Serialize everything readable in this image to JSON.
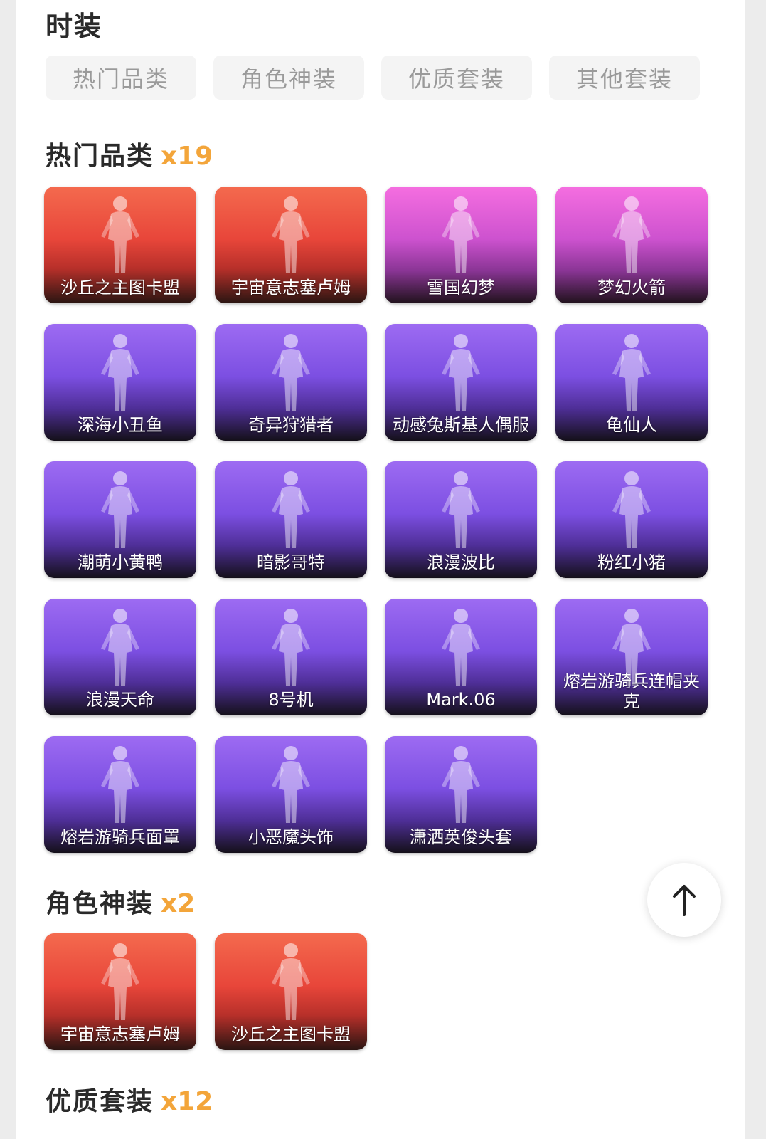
{
  "page": {
    "title": "时装"
  },
  "tabs": [
    {
      "label": "热门品类"
    },
    {
      "label": "角色神装"
    },
    {
      "label": "优质套装"
    },
    {
      "label": "其他套装"
    }
  ],
  "sections": [
    {
      "title": "热门品类",
      "count": "x19",
      "items": [
        {
          "label": "沙丘之主图卡盟",
          "theme": "red"
        },
        {
          "label": "宇宙意志塞卢姆",
          "theme": "red"
        },
        {
          "label": "雪国幻梦",
          "theme": "pink"
        },
        {
          "label": "梦幻火箭",
          "theme": "pink"
        },
        {
          "label": "深海小丑鱼",
          "theme": "purple"
        },
        {
          "label": "奇异狩猎者",
          "theme": "purple"
        },
        {
          "label": "动感兔斯基人偶服",
          "theme": "purple"
        },
        {
          "label": "龟仙人",
          "theme": "purple"
        },
        {
          "label": "潮萌小黄鸭",
          "theme": "purple"
        },
        {
          "label": "暗影哥特",
          "theme": "purple"
        },
        {
          "label": "浪漫波比",
          "theme": "purple"
        },
        {
          "label": "粉红小猪",
          "theme": "purple"
        },
        {
          "label": "浪漫天命",
          "theme": "purple"
        },
        {
          "label": "8号机",
          "theme": "purple"
        },
        {
          "label": "Mark.06",
          "theme": "purple"
        },
        {
          "label": "熔岩游骑兵连帽夹克",
          "theme": "purple"
        },
        {
          "label": "熔岩游骑兵面罩",
          "theme": "purple"
        },
        {
          "label": "小恶魔头饰",
          "theme": "purple"
        },
        {
          "label": "潇洒英俊头套",
          "theme": "purple"
        }
      ]
    },
    {
      "title": "角色神装",
      "count": "x2",
      "items": [
        {
          "label": "宇宙意志塞卢姆",
          "theme": "red"
        },
        {
          "label": "沙丘之主图卡盟",
          "theme": "red"
        }
      ]
    },
    {
      "title": "优质套装",
      "count": "x12",
      "items": []
    }
  ],
  "scroll_top": {
    "icon": "arrow-up-icon"
  },
  "colors": {
    "accent_count": "#f3a53a",
    "tab_bg": "#f4f4f4",
    "tab_text": "#9a9a9a"
  }
}
